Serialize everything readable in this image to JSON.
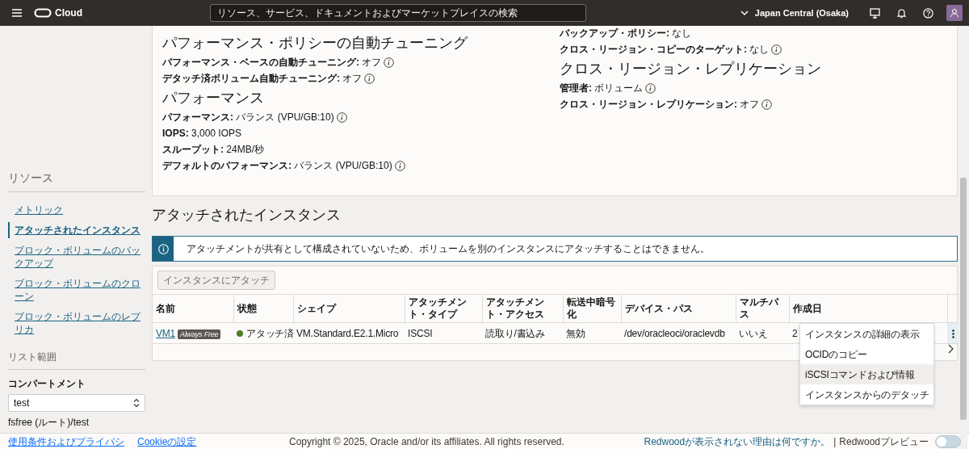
{
  "topbar": {
    "logo": "Cloud",
    "search": {
      "placeholder": "リソース、サービス、ドキュメントおよびマーケットプレイスの検索"
    },
    "region": "Japan Central (Osaka)"
  },
  "details": {
    "left": [
      {
        "kind": "heading",
        "text": "パフォーマンス・ポリシーの自動チューニング"
      },
      {
        "kind": "field",
        "label": "パフォーマンス・ベースの自動チューニング:",
        "value": "オフ",
        "info": true
      },
      {
        "kind": "field",
        "label": "デタッチ済ボリューム自動チューニング:",
        "value": "オフ",
        "info": true
      },
      {
        "kind": "heading",
        "text": "パフォーマンス"
      },
      {
        "kind": "field",
        "label": "パフォーマンス:",
        "value": "バランス (VPU/GB:10)",
        "info": true
      },
      {
        "kind": "field",
        "label": "IOPS:",
        "value": "3,000 IOPS",
        "info": false
      },
      {
        "kind": "field",
        "label": "スループット:",
        "value": "24MB/秒",
        "info": false
      },
      {
        "kind": "field",
        "label": "デフォルトのパフォーマンス:",
        "value": "バランス (VPU/GB:10)",
        "info": true
      }
    ],
    "right": [
      {
        "kind": "field",
        "label": "バックアップ・ポリシー:",
        "value": "なし",
        "info": false
      },
      {
        "kind": "field",
        "label": "クロス・リージョン・コピーのターゲット:",
        "value": "なし",
        "info": true
      },
      {
        "kind": "heading",
        "text": "クロス・リージョン・レプリケーション"
      },
      {
        "kind": "field",
        "label": "管理者:",
        "value": "ボリューム",
        "info": true
      },
      {
        "kind": "field",
        "label": "クロス・リージョン・レプリケーション:",
        "value": "オフ",
        "info": true
      }
    ]
  },
  "sidebar": {
    "title": "リソース",
    "items": [
      {
        "label": "メトリック",
        "selected": false
      },
      {
        "label": "アタッチされたインスタンス",
        "selected": true
      },
      {
        "label": "ブロック・ボリュームのバックアップ",
        "selected": false
      },
      {
        "label": "ブロック・ボリュームのクローン",
        "selected": false
      },
      {
        "label": "ブロック・ボリュームのレプリカ",
        "selected": false
      }
    ],
    "scope_title": "リスト範囲",
    "compartment_label": "コンパートメント",
    "compartment_value": "test",
    "compartment_path": "fsfree (ルート)/test"
  },
  "attached": {
    "title": "アタッチされたインスタンス",
    "notice": "アタッチメントが共有として構成されていないため、ボリュームを別のインスタンスにアタッチすることはできません。",
    "attach_button": {
      "label": "インスタンスにアタッチ",
      "disabled": true
    },
    "columns": [
      "名前",
      "状態",
      "シェイプ",
      "アタッチメント・タイプ",
      "アタッチメント・アクセス",
      "転送中暗号化",
      "デバイス・パス",
      "マルチパス",
      "作成日"
    ],
    "rows": [
      {
        "name": "VM1",
        "badge": "Always Free",
        "status": "アタッチ済",
        "color": "#4f7d22",
        "shape": "VM.Standard.E2.1.Micro",
        "attachment_type": "ISCSI",
        "access": "読取り/書込み",
        "encryption": "無効",
        "device_path": "/dev/oracleoci/oraclevdb",
        "multipath": "いいえ",
        "created": "2",
        "menu_open": true
      }
    ],
    "row_menu": [
      {
        "label": "インスタンスの詳細の表示",
        "selected": false
      },
      {
        "label": "OCIDのコピー",
        "selected": false
      },
      {
        "label": "iSCSIコマンドおよび情報",
        "selected": true
      },
      {
        "label": "インスタンスからのデタッチ",
        "selected": false
      }
    ]
  },
  "footer": {
    "links": [
      "使用条件およびプライバシ",
      "Cookieの設定"
    ],
    "copyright": "Copyright © 2025, Oracle and/or its affiliates. All rights reserved.",
    "why_link": "Redwoodが表示されない理由は何ですか。",
    "separator": "|",
    "preview_label": "Redwoodプレビュー",
    "preview_on": false
  }
}
